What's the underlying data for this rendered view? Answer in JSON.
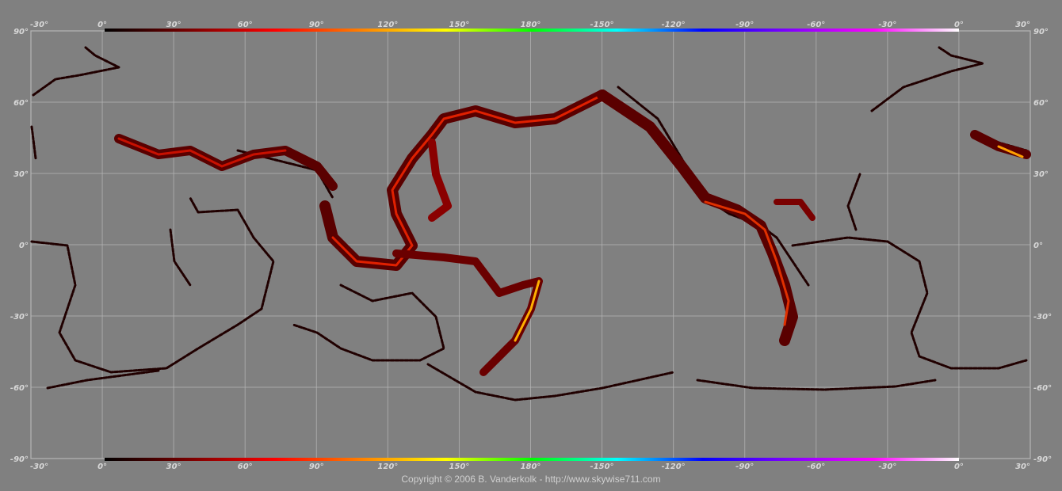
{
  "map": {
    "type": "equirectangular_grid",
    "lat_labels": [
      "90°",
      "60°",
      "30°",
      "0°",
      "-30°",
      "-60°",
      "-90°"
    ],
    "lon_labels": [
      "-30°",
      "0°",
      "30°",
      "60°",
      "90°",
      "120°",
      "150°",
      "180°",
      "-150°",
      "-120°",
      "-90°",
      "-60°",
      "-30°",
      "0°",
      "30°"
    ],
    "scale_colors": [
      "#000000",
      "#7a0000",
      "#ff0000",
      "#ff8000",
      "#ffff00",
      "#00ff00",
      "#00ffff",
      "#0000ff",
      "#8000ff",
      "#ff00ff",
      "#ffffff"
    ],
    "background": "#808080",
    "grid_color": "#b8b8b8",
    "coast_color": "#200000"
  },
  "footer": {
    "copyright": "Copyright © 2006 B. Vanderkolk - http://www.skywise711.com"
  }
}
